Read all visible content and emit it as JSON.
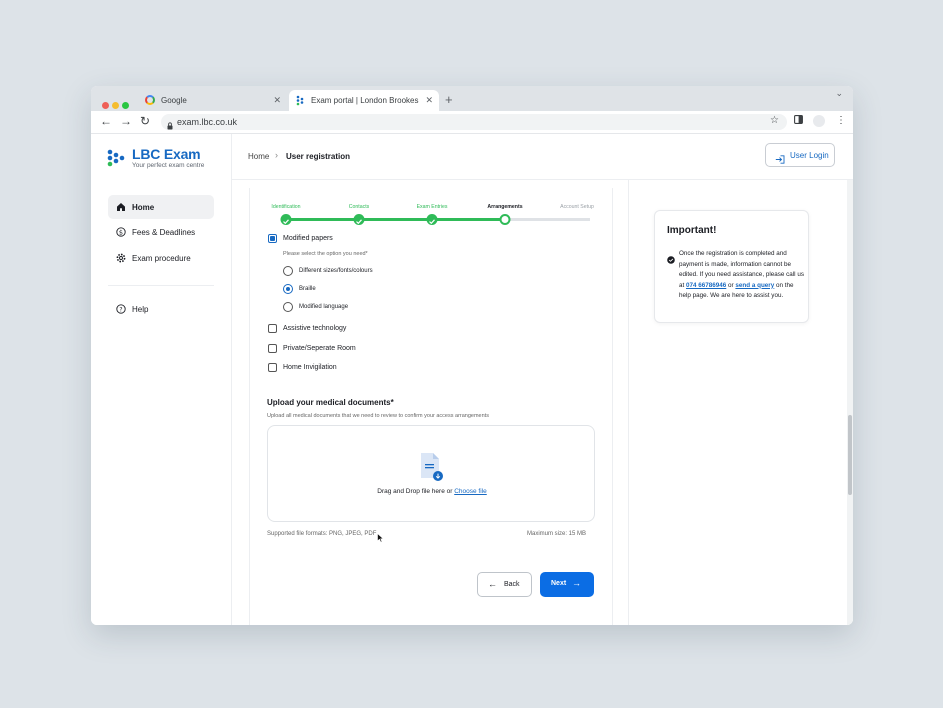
{
  "browser": {
    "tabs": [
      {
        "title": "Google"
      },
      {
        "title": "Exam portal | London Brookes College"
      }
    ],
    "url": "exam.lbc.co.uk"
  },
  "brand": {
    "title": "LBC Exam",
    "tagline": "Your perfect exam centre",
    "accent_color": "#1769c2"
  },
  "sidebar": {
    "items": [
      {
        "label": "Home",
        "icon": "home-icon",
        "active": true
      },
      {
        "label": "Fees & Deadlines",
        "icon": "dollar-icon",
        "active": false
      },
      {
        "label": "Exam procedure",
        "icon": "gear-icon",
        "active": false
      }
    ],
    "help": {
      "label": "Help",
      "icon": "help-circle-icon"
    }
  },
  "header": {
    "breadcrumb_home": "Home",
    "breadcrumb_current": "User registration",
    "login_label": "User Login"
  },
  "stepper": {
    "steps": [
      {
        "label": "Identification",
        "status": "done"
      },
      {
        "label": "Contacts",
        "status": "done"
      },
      {
        "label": "Exam Entries",
        "status": "done"
      },
      {
        "label": "Arrangements",
        "status": "current"
      },
      {
        "label": "Account Setup",
        "status": "todo"
      }
    ]
  },
  "form": {
    "modified_papers": {
      "label": "Modified papers",
      "checked": true
    },
    "option_prompt": "Please select the option you need*",
    "options": [
      {
        "label": "Different sizes/fonts/colours",
        "selected": false
      },
      {
        "label": "Braille",
        "selected": true
      },
      {
        "label": "Modified language",
        "selected": false
      }
    ],
    "assistive": {
      "label": "Assistive technology",
      "checked": false
    },
    "private_room": {
      "label": "Private/Seperate Room",
      "checked": false
    },
    "home_invigilation": {
      "label": "Home Invigilation",
      "checked": false
    },
    "upload": {
      "title": "Upload your medical documents*",
      "subtitle": "Upload all medical documents that we need to review to confirm your access arrangements",
      "drop_text": "Drag and Drop file here or ",
      "choose_link": "Choose file",
      "formats": "Supported file formats: PNG, JPEG, PDF",
      "max_size": "Maximum size: 15 MB"
    },
    "back_label": "Back",
    "next_label": "Next"
  },
  "notice": {
    "title": "Important!",
    "text_before": "Once the registration is completed and payment is made, information cannot be edited. If you need assistance, please call us at ",
    "phone": "074 66786946",
    "text_mid": " or ",
    "link": "send a query",
    "text_after": " on the help page. We are here to assist you."
  },
  "colors": {
    "success": "#2fbb58",
    "primary_button": "#0b6de4"
  }
}
